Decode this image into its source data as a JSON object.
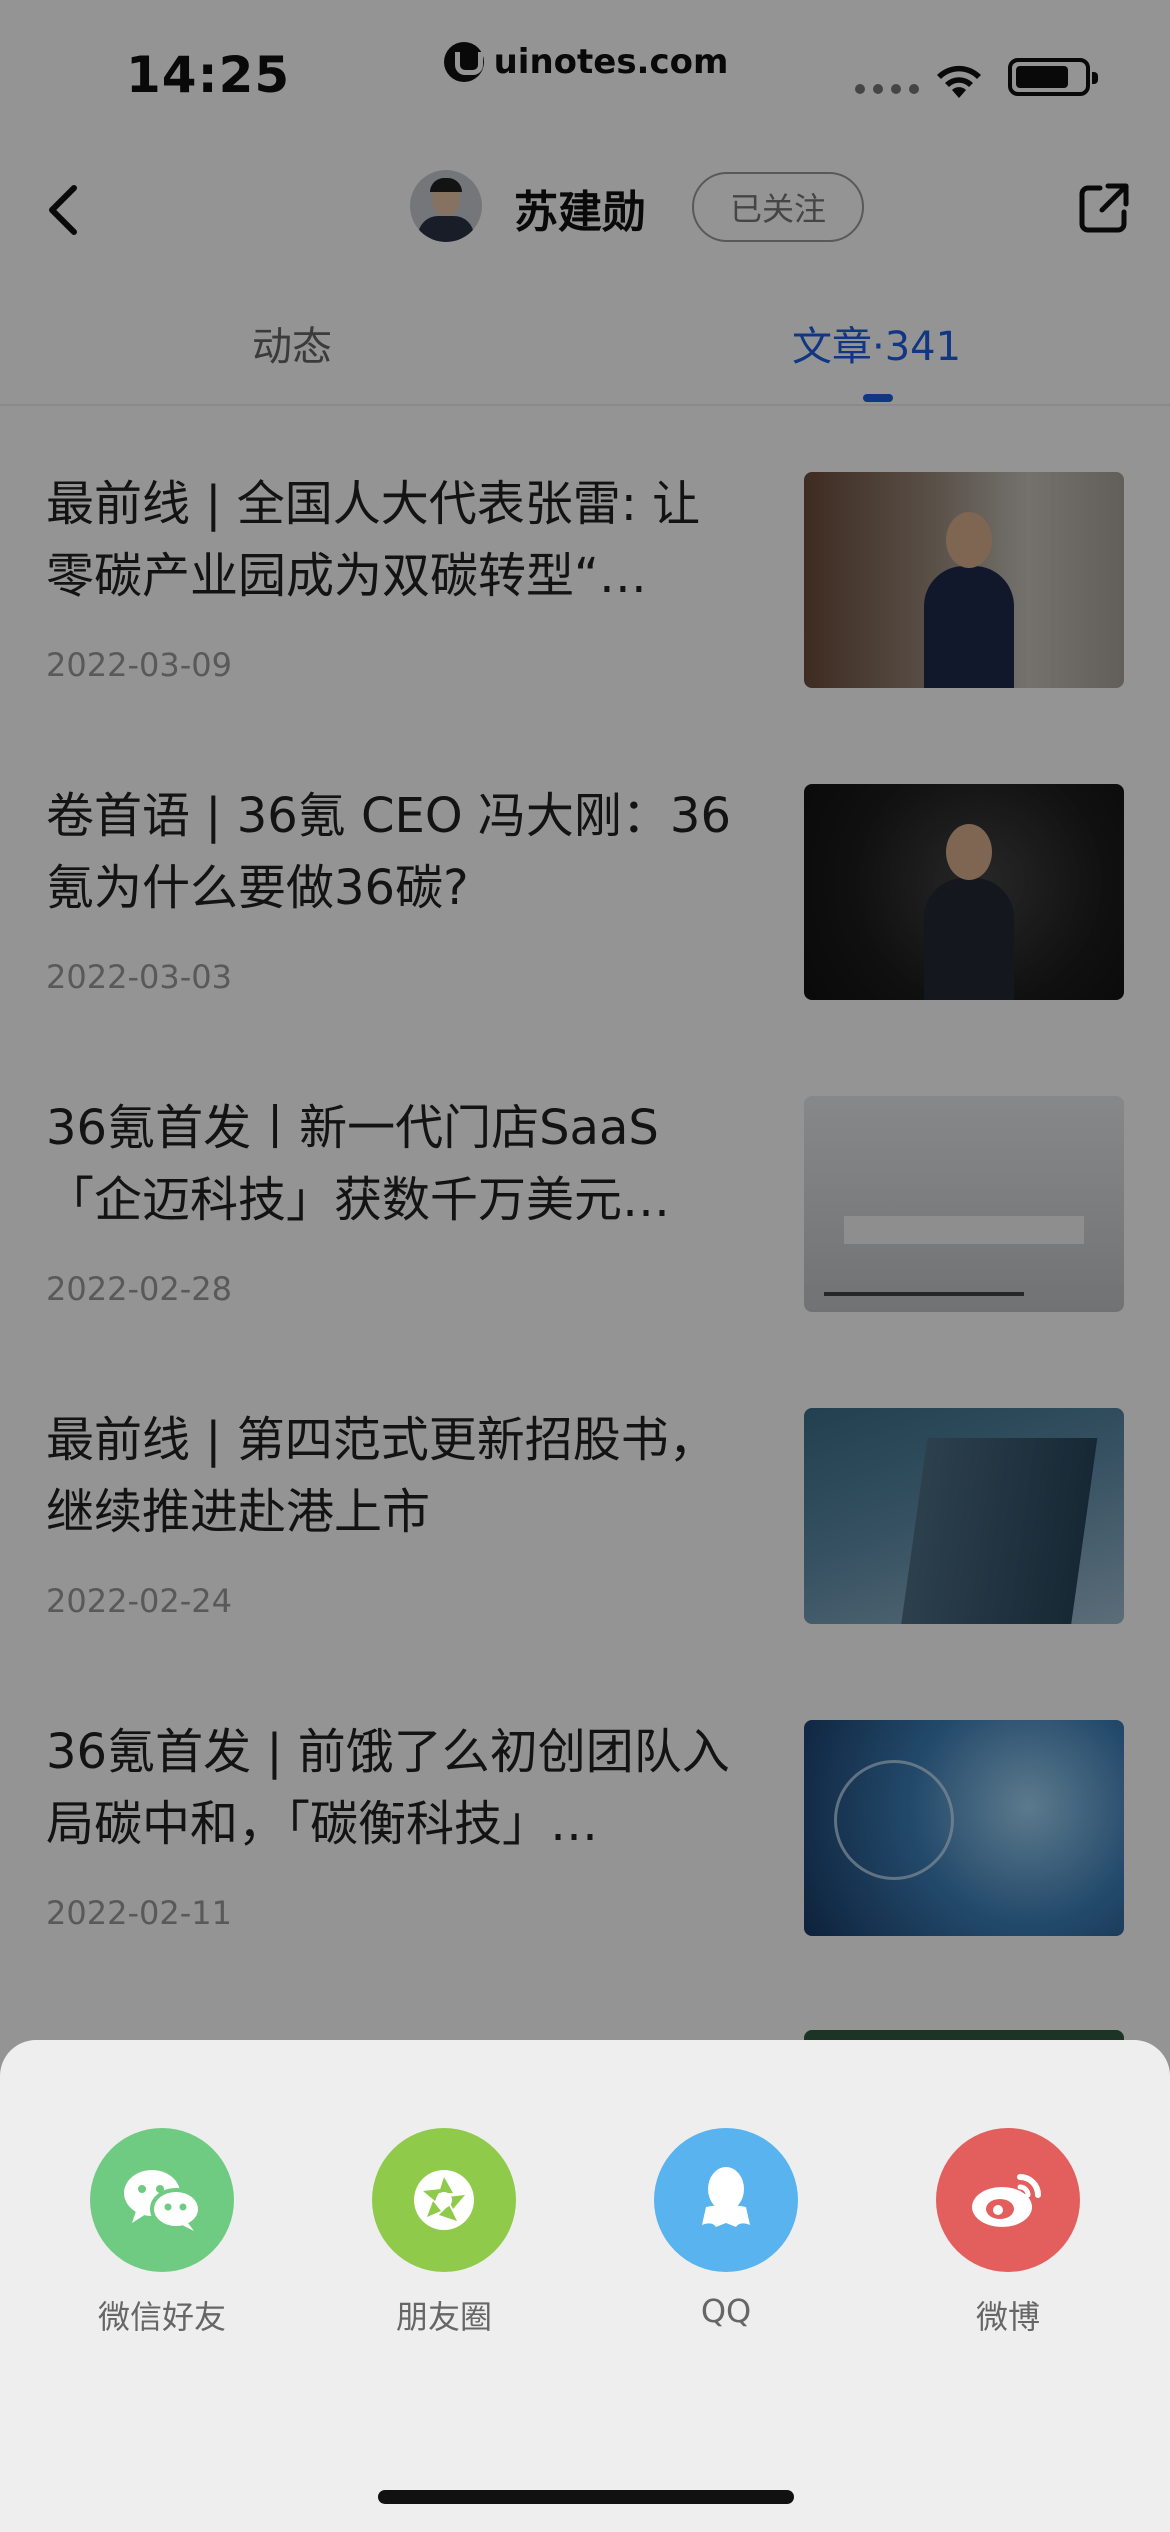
{
  "status_bar": {
    "time": "14:25",
    "watermark": "uinotes.com"
  },
  "nav": {
    "author_name": "苏建勋",
    "follow_label": "已关注",
    "back_icon": "chevron-left-icon",
    "share_icon": "share-external-icon"
  },
  "tabs": [
    {
      "label": "动态",
      "active": false
    },
    {
      "label": "文章·341",
      "active": true
    }
  ],
  "articles": [
    {
      "title": "最前线 | 全国人大代表张雷: 让零碳产业园成为双碳转型“…",
      "date": "2022-03-09"
    },
    {
      "title": "卷首语 | 36氪 CEO 冯大刚：36氪为什么要做36碳?",
      "date": "2022-03-03"
    },
    {
      "title": "36氪首发丨新一代门店SaaS「企迈科技」获数千万美元…",
      "date": "2022-02-28"
    },
    {
      "title": "最前线 | 第四范式更新招股书，继续推进赴港上市",
      "date": "2022-02-24"
    },
    {
      "title": "36氪首发 | 前饿了么初创团队入局碳中和，「碳衡科技」…",
      "date": "2022-02-11"
    }
  ],
  "share_sheet": {
    "options": [
      {
        "label": "微信好友",
        "icon": "wechat-icon",
        "color": "#6fcb82"
      },
      {
        "label": "朋友圈",
        "icon": "moments-icon",
        "color": "#8fca4a"
      },
      {
        "label": "QQ",
        "icon": "qq-icon",
        "color": "#58b3ee"
      },
      {
        "label": "微博",
        "icon": "weibo-icon",
        "color": "#e35f5e"
      }
    ]
  },
  "colors": {
    "accent": "#1f5fe0",
    "overlay": "rgba(0,0,0,0.42)",
    "sheet_bg": "#eeeeef"
  }
}
